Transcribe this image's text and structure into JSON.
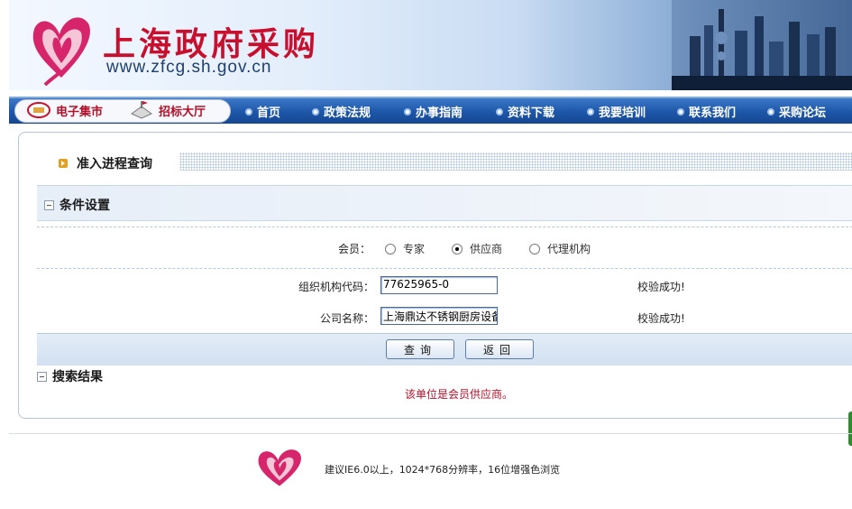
{
  "header": {
    "site_title": "上海政府采购",
    "site_url": "www.zfcg.sh.gov.cn"
  },
  "nav": {
    "pill_items": [
      {
        "label": "电子集市",
        "icon": "mall-icon"
      },
      {
        "label": "招标大厅",
        "icon": "bidding-hall-icon"
      }
    ],
    "items": [
      "首页",
      "政策法规",
      "办事指南",
      "资料下载",
      "我要培训",
      "联系我们",
      "采购论坛"
    ]
  },
  "page": {
    "heading": "准入进程查询"
  },
  "conditions": {
    "section_title": "条件设置",
    "member_label": "会员：",
    "member_options": [
      {
        "label": "专家",
        "checked": false
      },
      {
        "label": "供应商",
        "checked": true
      },
      {
        "label": "代理机构",
        "checked": false
      }
    ],
    "org_code_label": "组织机构代码：",
    "org_code_value": "77625965-0",
    "org_code_status": "校验成功!",
    "company_label": "公司名称：",
    "company_value": "上海鼎达不锈钢厨房设备",
    "company_status": "校验成功!"
  },
  "buttons": {
    "query": "查询",
    "back": "返回"
  },
  "results": {
    "section_title": "搜索结果",
    "message": "该单位是会员供应商。"
  },
  "footer": {
    "note": "建议IE6.0以上，1024*768分辨率，16位增强色浏览"
  },
  "colors": {
    "brand_red": "#c8102e",
    "nav_blue": "#1d56a8",
    "result_red": "#b0102a"
  }
}
